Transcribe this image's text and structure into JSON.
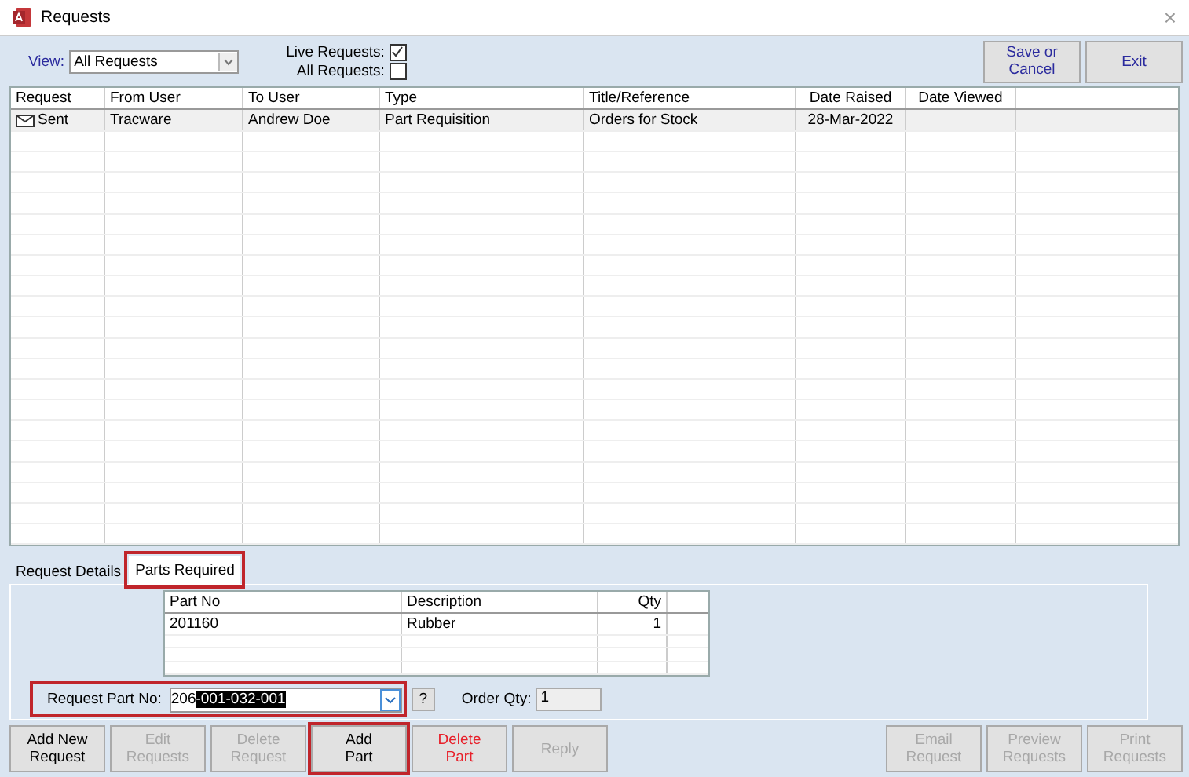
{
  "window": {
    "title": "Requests",
    "close": "×"
  },
  "toolbar": {
    "view_label": "View:",
    "view_value": "All Requests",
    "filters": [
      {
        "label": "Live Requests:",
        "checked": true
      },
      {
        "label": "All Requests:",
        "checked": false
      }
    ],
    "buttons": [
      {
        "label": "Save or\nCancel",
        "disabled": false
      },
      {
        "label": "Exit",
        "disabled": false
      }
    ]
  },
  "table": {
    "columns": [
      "Request",
      "From User",
      "To User",
      "Type",
      "Title/Reference",
      "Date Raised",
      "Date Viewed"
    ],
    "rows": [
      {
        "cells": [
          "Sent",
          "Tracware",
          "Andrew Doe",
          "Part Requisition",
          "Orders for Stock",
          "28-Mar-2022",
          ""
        ],
        "selected": true
      }
    ]
  },
  "tabs": [
    {
      "label": "Request Details",
      "selected": false,
      "highlighted": false
    },
    {
      "label": "Parts Required",
      "selected": true,
      "highlighted": true
    }
  ],
  "parts": {
    "columns": [
      "Part No",
      "Description",
      "Qty"
    ],
    "rows": [
      {
        "cells": [
          "201160",
          "Rubber",
          "1"
        ]
      }
    ],
    "request_part_label": "Request Part No:",
    "request_part_prefix": "206",
    "request_part_selected": "-001-032-001",
    "request_part_highlighted": true,
    "help": "?",
    "order_qty_label": "Order Qty:",
    "order_qty": "1"
  },
  "buttons_left": [
    {
      "label": "Add New\nRequest",
      "disabled": false,
      "kind": "normal",
      "highlighted": false
    },
    {
      "label": "Edit\nRequests",
      "disabled": true,
      "kind": "normal",
      "highlighted": false
    },
    {
      "label": "Delete\nRequest",
      "disabled": true,
      "kind": "normal",
      "highlighted": false
    },
    {
      "label": "Add\nPart",
      "disabled": false,
      "kind": "normal",
      "highlighted": true
    },
    {
      "label": "Delete\nPart",
      "disabled": false,
      "kind": "danger",
      "highlighted": false
    },
    {
      "label": "Reply",
      "disabled": true,
      "kind": "normal",
      "highlighted": false
    }
  ],
  "buttons_right": [
    {
      "label": "Email\nRequest",
      "disabled": true,
      "highlighted": false
    },
    {
      "label": "Preview\nRequests",
      "disabled": true,
      "highlighted": false
    },
    {
      "label": "Print\nRequests",
      "disabled": true,
      "highlighted": false
    }
  ]
}
